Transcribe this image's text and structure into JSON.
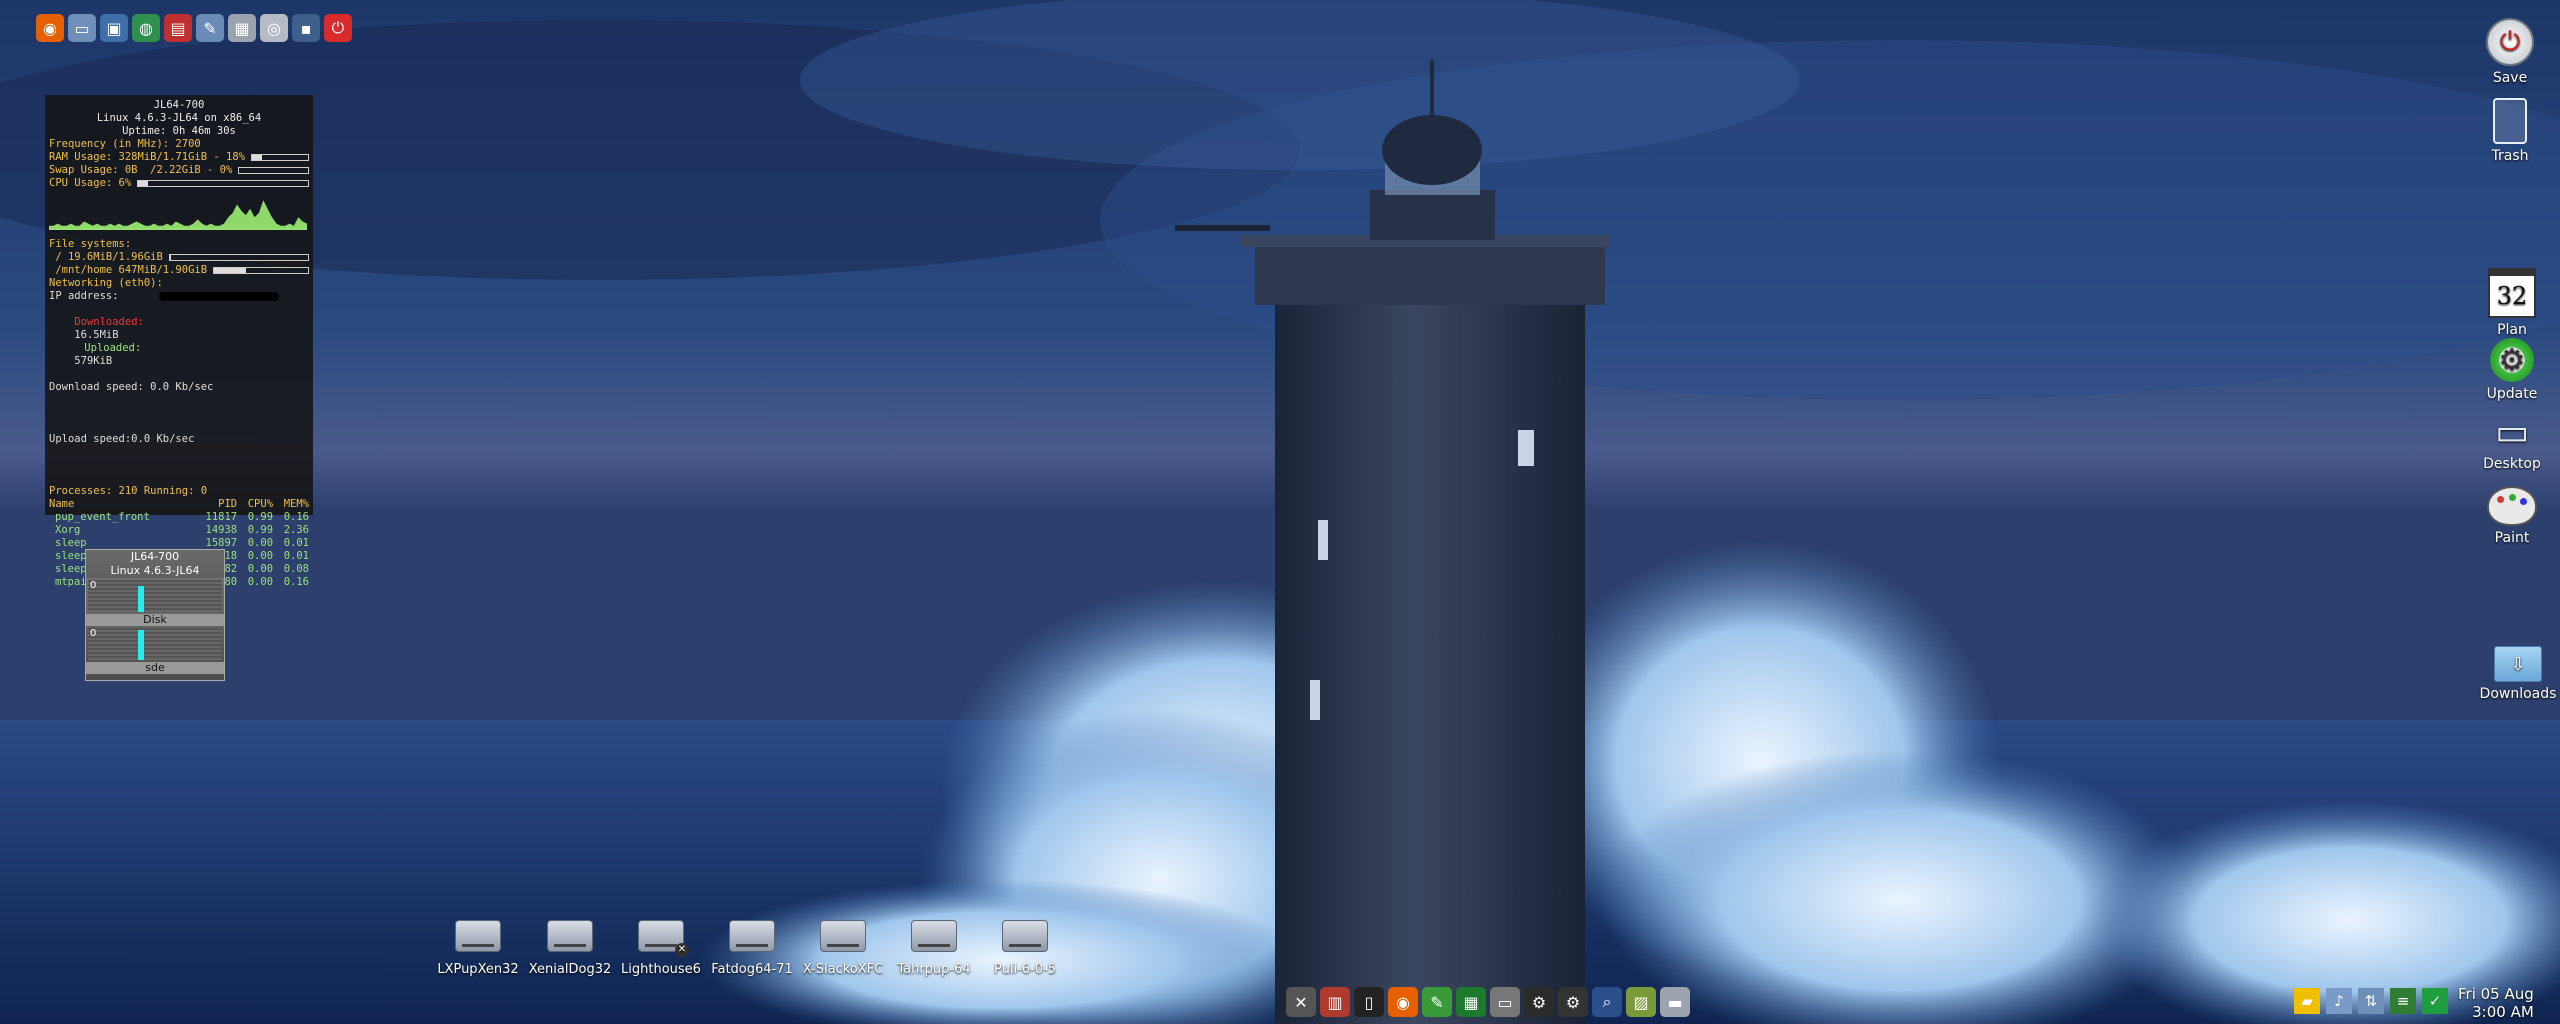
{
  "launcher_icons": [
    {
      "name": "firefox-icon",
      "glyph": "◉",
      "color": "#e66000"
    },
    {
      "name": "folder-icon",
      "glyph": "▭",
      "color": "#6f8fb8"
    },
    {
      "name": "monitor-icon",
      "glyph": "▣",
      "color": "#3f6fa8"
    },
    {
      "name": "globe-icon",
      "glyph": "◍",
      "color": "#2f8f4f"
    },
    {
      "name": "document-icon",
      "glyph": "▤",
      "color": "#c03030"
    },
    {
      "name": "draw-icon",
      "glyph": "✎",
      "color": "#6a8ab8"
    },
    {
      "name": "calculator-icon",
      "glyph": "▦",
      "color": "#9aa3ae"
    },
    {
      "name": "disc-icon",
      "glyph": "◎",
      "color": "#b5bcc6"
    },
    {
      "name": "camera-icon",
      "glyph": "▪",
      "color": "#3d5f8c"
    },
    {
      "name": "power-icon",
      "glyph": "⏻",
      "color": "#d92b2b"
    }
  ],
  "conky": {
    "hostname": "JL64-700",
    "kernel": "Linux 4.6.3-JL64 on x86_64",
    "uptime": "Uptime: 0h 46m 30s",
    "frequency": "Frequency (in MHz): 2700",
    "ram": "RAM Usage: 328MiB/1.71GiB - 18%",
    "ram_fraction": 0.18,
    "swap": "Swap Usage: 0B  /2.22GiB - 0%",
    "swap_fraction": 0.0,
    "cpu": "CPU Usage: 6%",
    "cpu_fraction": 0.06,
    "cpu_history": [
      2,
      2,
      3,
      2,
      2,
      3,
      2,
      2,
      4,
      3,
      2,
      3,
      2,
      2,
      3,
      2,
      3,
      2,
      2,
      3,
      4,
      3,
      2,
      2,
      3,
      2,
      2,
      3,
      2,
      4,
      3,
      2,
      2,
      3,
      5,
      3,
      2,
      3,
      2,
      2,
      3,
      6,
      8,
      12,
      9,
      7,
      10,
      6,
      8,
      14,
      10,
      6,
      3,
      2,
      2,
      3,
      2,
      6,
      4,
      3
    ],
    "fs_title": "File systems:",
    "fs_root": " / 19.6MiB/1.96GiB",
    "fs_root_fraction": 0.01,
    "fs_home": " /mnt/home 647MiB/1.90GiB",
    "fs_home_fraction": 0.34,
    "net_title": "Networking (eth0):",
    "ip_label": "IP address:",
    "downloaded_label": "Downloaded:",
    "downloaded_value": "16.5MiB",
    "uploaded_label": "Uploaded:",
    "uploaded_value": "579KiB",
    "download_speed": "Download speed: 0.0 Kb/sec",
    "upload_speed": "Upload speed:0.0 Kb/sec",
    "processes": "Processes: 210  Running: 0",
    "proc_headers": [
      "Name",
      "PID",
      "CPU%",
      "MEM%"
    ],
    "procs": [
      [
        "pup_event_front",
        "11817",
        "0.99",
        "0.16"
      ],
      [
        "Xorg",
        "14938",
        "0.99",
        "2.36"
      ],
      [
        "sleep",
        "15897",
        "0.00",
        "0.01"
      ],
      [
        "sleep",
        "15718",
        "0.00",
        "0.01"
      ],
      [
        "sleep",
        "15582",
        "0.00",
        "0.08"
      ],
      [
        "mtpaintsnapshot",
        "15580",
        "0.00",
        "0.16"
      ]
    ]
  },
  "diskmon": {
    "host": "JL64-700",
    "kernel": "Linux 4.6.3-JL64",
    "zero1": "0",
    "zero2": "0",
    "label1": "Disk",
    "label2": "sde"
  },
  "right_icons": {
    "save": "Save",
    "trash": "Trash",
    "plan": "Plan",
    "plan_day": "32",
    "update": "Update",
    "desktop": "Desktop",
    "paint": "Paint",
    "downloads": "Downloads"
  },
  "drives": [
    "LXPupXen32",
    "XenialDog32",
    "Lighthouse6",
    "Fatdog64-71",
    "X-SlackoXFC",
    "Tahrpup-64",
    "Puli-6-0-5"
  ],
  "taskbar_icons": [
    {
      "name": "x-menu-icon",
      "glyph": "✕",
      "color": "#555"
    },
    {
      "name": "toolbox-icon",
      "glyph": "▥",
      "color": "#b03a2e"
    },
    {
      "name": "terminal-icon",
      "glyph": "▯",
      "color": "#222"
    },
    {
      "name": "firefox-icon",
      "glyph": "◉",
      "color": "#e66000"
    },
    {
      "name": "edit-icon",
      "glyph": "✎",
      "color": "#3a9a3a"
    },
    {
      "name": "spreadsheet-icon",
      "glyph": "▦",
      "color": "#1d7a2d"
    },
    {
      "name": "laptop-icon",
      "glyph": "▭",
      "color": "#777"
    },
    {
      "name": "settings-icon",
      "glyph": "⚙",
      "color": "#2b2b2b"
    },
    {
      "name": "gear-icon",
      "glyph": "⚙",
      "color": "#333"
    },
    {
      "name": "search-icon",
      "glyph": "⌕",
      "color": "#2a4f8a"
    },
    {
      "name": "image-viewer-icon",
      "glyph": "▨",
      "color": "#7a9a3a"
    },
    {
      "name": "drive-icon",
      "glyph": "▬",
      "color": "#9aa3ae"
    }
  ],
  "tray_icons": [
    {
      "name": "folder-tray-icon",
      "glyph": "▰",
      "color": "#f0c000"
    },
    {
      "name": "volume-icon",
      "glyph": "♪",
      "color": "#7a9ac8"
    },
    {
      "name": "network-icon",
      "glyph": "⇅",
      "color": "#6d8fb8"
    },
    {
      "name": "layers-icon",
      "glyph": "≡",
      "color": "#2e7d32"
    },
    {
      "name": "shield-icon",
      "glyph": "✓",
      "color": "#1e9e3e"
    }
  ],
  "clock": {
    "date": "Fri 05 Aug",
    "time": "3:00 AM"
  }
}
